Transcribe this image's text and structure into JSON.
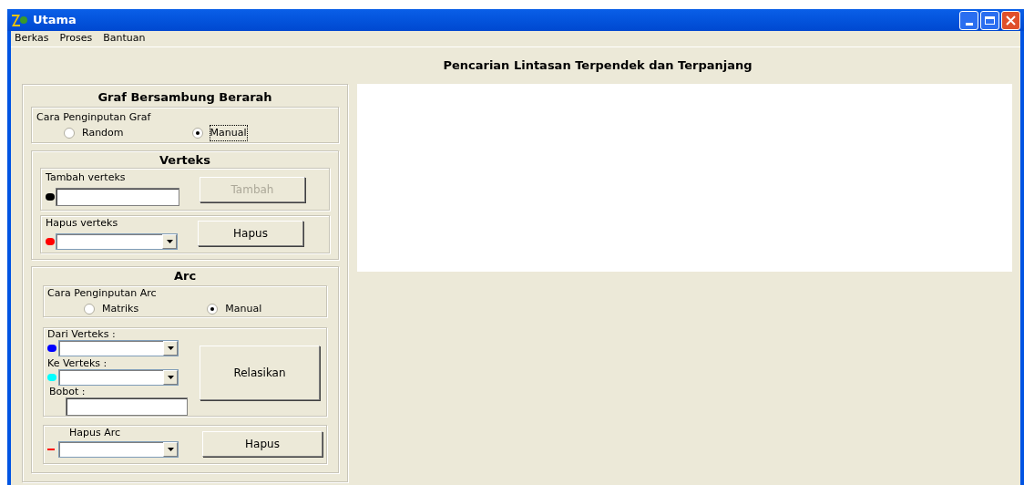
{
  "window": {
    "title": "Utama"
  },
  "menu": [
    "Berkas",
    "Proses",
    "Bantuan"
  ],
  "heading": "Pencarian Lintasan Terpendek dan Terpanjang",
  "panel": {
    "title": "Graf Bersambung Berarah",
    "graph_input": {
      "label": "Cara Penginputan Graf",
      "options": [
        {
          "label": "Random",
          "selected": false
        },
        {
          "label": "Manual",
          "selected": true
        }
      ]
    },
    "vertex": {
      "title": "Verteks",
      "add": {
        "label": "Tambah verteks",
        "button": "Tambah",
        "button_disabled": true,
        "color": "#000000"
      },
      "remove": {
        "label": "Hapus verteks",
        "button": "Hapus",
        "button_disabled": false,
        "color": "#ff0000"
      }
    },
    "arc": {
      "title": "Arc",
      "arc_input": {
        "label": "Cara Penginputan Arc",
        "options": [
          {
            "label": "Matriks",
            "selected": false
          },
          {
            "label": "Manual",
            "selected": true
          }
        ]
      },
      "from": {
        "label": "Dari Verteks :",
        "color": "#0000ff"
      },
      "to": {
        "label": "Ke Verteks :",
        "color": "#00ffff"
      },
      "weight": {
        "label": "Bobot :"
      },
      "relate_button": "Relasikan",
      "remove": {
        "label": "Hapus Arc",
        "button": "Hapus",
        "color": "#ff0000"
      }
    }
  }
}
